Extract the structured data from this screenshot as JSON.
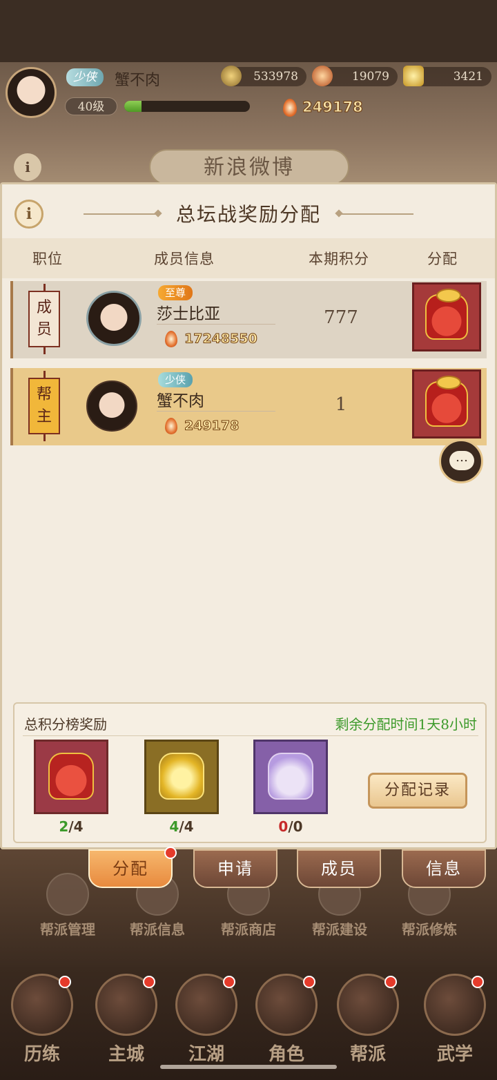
{
  "hud": {
    "title_badge": "少侠",
    "player_name": "蟹不肉",
    "level": "40级",
    "exp_fraction": 0.14,
    "coins": "533978",
    "gems": "19079",
    "gold": "3421",
    "power": "249178",
    "banner": "新浪微博"
  },
  "panel": {
    "info_label": "i",
    "title": "总坛战奖励分配",
    "columns": [
      "职位",
      "成员信息",
      "本期积分",
      "分配"
    ],
    "members": [
      {
        "role": "成员",
        "rank": "至尊",
        "name": "莎士比亚",
        "power": "17248550",
        "score": "777"
      },
      {
        "role": "帮主",
        "rank": "少侠",
        "name": "蟹不肉",
        "power": "249178",
        "score": "1"
      }
    ],
    "chat_icon": "…"
  },
  "rewards": {
    "title": "总积分榜奖励",
    "remaining": "剩余分配时间1天8小时",
    "items": [
      {
        "icon": "red-gift-bag-icon",
        "count_a": "2",
        "sep": "/",
        "count_b": "4"
      },
      {
        "icon": "gold-gift-bag-icon",
        "count_a": "4",
        "sep": "/",
        "count_b": "4"
      },
      {
        "icon": "purple-gift-bag-icon",
        "count_a": "0",
        "sep": "/",
        "count_b": "0"
      }
    ],
    "record_button": "分配记录"
  },
  "tabs": [
    "分配",
    "申请",
    "成员",
    "信息"
  ],
  "guild_functions": [
    "帮派管理",
    "帮派信息",
    "帮派商店",
    "帮派建设",
    "帮派修炼"
  ],
  "nav": [
    "历练",
    "主城",
    "江湖",
    "角色",
    "帮派",
    "武学"
  ],
  "colors": {
    "accent_green": "#3c9a2a",
    "accent_red": "#c62a2a",
    "tab_active": "#e88a3e"
  }
}
